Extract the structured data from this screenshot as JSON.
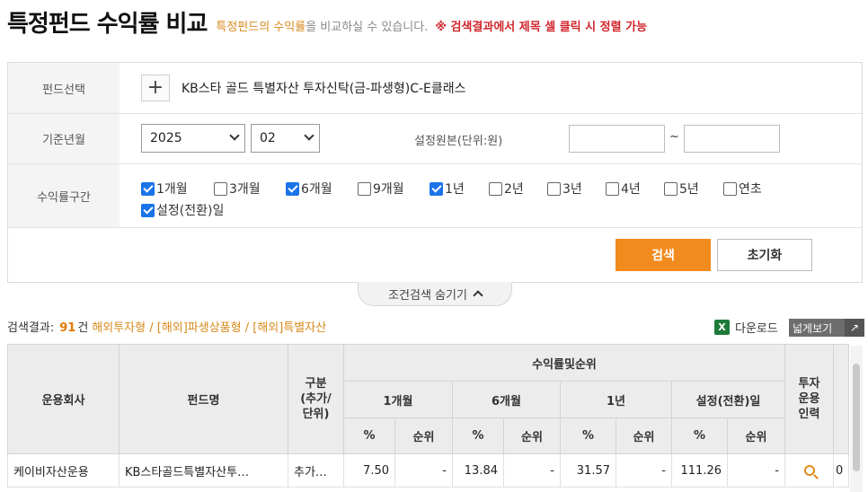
{
  "header": {
    "title": "특정펀드 수익률 비교",
    "subtitle_highlight": "특정펀드의 수익률",
    "subtitle_rest": "을 비교하실 수 있습니다.",
    "notice": "※ 검색결과에서 제목 셀 클릭 시 정렬 가능"
  },
  "form": {
    "fund_select_label": "펀드선택",
    "fund_name": "KB스타 골드 특별자산 투자신탁(금-파생형)C-E클래스",
    "base_month_label": "기준년월",
    "year": "2025",
    "month": "02",
    "principal_label": "설정원본(단위:원)",
    "principal_from": "",
    "principal_to": "",
    "tilde": "~",
    "return_range_label": "수익률구간",
    "periods": [
      {
        "label": "1개월",
        "checked": true
      },
      {
        "label": "3개월",
        "checked": false
      },
      {
        "label": "6개월",
        "checked": true
      },
      {
        "label": "9개월",
        "checked": false
      },
      {
        "label": "1년",
        "checked": true
      },
      {
        "label": "2년",
        "checked": false
      },
      {
        "label": "3년",
        "checked": false
      },
      {
        "label": "4년",
        "checked": false
      },
      {
        "label": "5년",
        "checked": false
      },
      {
        "label": "연초",
        "checked": false
      },
      {
        "label": "설정(전환)일",
        "checked": true
      }
    ],
    "search_button": "검색",
    "reset_button": "초기화"
  },
  "toggle": {
    "label": "조건검색 숨기기"
  },
  "results": {
    "label": "검색결과:",
    "count": "91",
    "unit": "건",
    "categories": "해외투자형 / [해외]파생상품형 / [해외]특별자산",
    "download": "다운로드",
    "excel_glyph": "X",
    "wide_view": "넓게보기",
    "wide_arrow": "↗"
  },
  "table": {
    "col_company": "운용회사",
    "col_fund": "펀드명",
    "col_type": "구분\n(추가/\n단위)",
    "col_group": "수익률및순위",
    "periods": [
      "1개월",
      "6개월",
      "1년",
      "설정(전환)일"
    ],
    "pct": "%",
    "rank": "순위",
    "col_invest": "투자\n운용\n인력",
    "rows": [
      {
        "company": "케이비자산운용",
        "fund": "KB스타골드특별자산투…",
        "type": "추가…",
        "r1m": "7.50",
        "k1m": "-",
        "r6m": "13.84",
        "k6m": "-",
        "r1y": "31.57",
        "k1y": "-",
        "rsi": "111.26",
        "ksi": "-",
        "extra": "0"
      }
    ]
  }
}
